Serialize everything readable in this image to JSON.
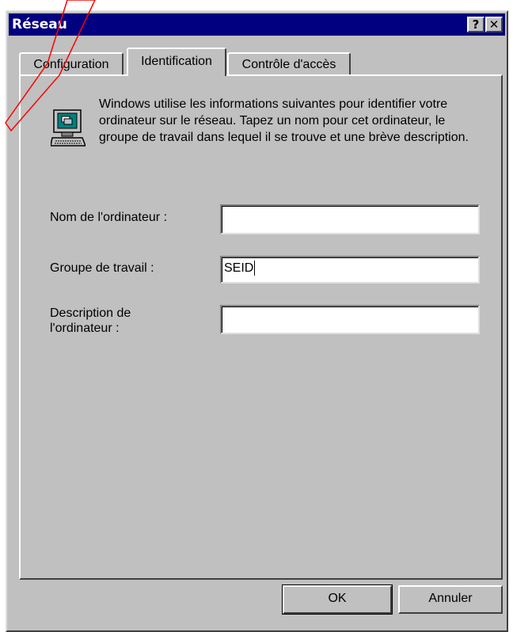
{
  "window": {
    "title": "Réseau"
  },
  "titlebar_buttons": {
    "help": "?",
    "close": "✕"
  },
  "tabs": [
    {
      "label": "Configuration",
      "active": false
    },
    {
      "label": "Identification",
      "active": true
    },
    {
      "label": "Contrôle d'accès",
      "active": false
    }
  ],
  "identification": {
    "icon": "computer-icon",
    "info_text": "Windows utilise les informations suivantes pour identifier votre ordinateur sur le réseau. Tapez un nom pour cet ordinateur, le groupe de travail dans lequel il se trouve et une brève description.",
    "fields": [
      {
        "label": "Nom de l'ordinateur :",
        "value": ""
      },
      {
        "label": "Groupe de travail :",
        "value": "SEID"
      },
      {
        "label": "Description de l'ordinateur :",
        "value": ""
      }
    ]
  },
  "buttons": {
    "ok": "OK",
    "cancel": "Annuler"
  },
  "colors": {
    "titlebar": "#000080",
    "face": "#c0c0c0",
    "annotation": "#ff0000"
  }
}
